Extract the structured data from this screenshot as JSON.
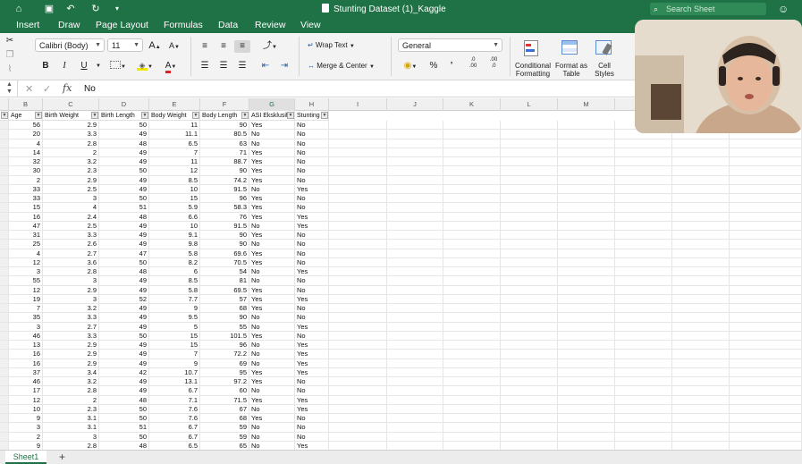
{
  "titlebar": {
    "title": "Stunting Dataset (1)_Kaggle",
    "search_placeholder": "Search Sheet",
    "quick_icons": [
      "home-icon",
      "save-icon",
      "undo-icon",
      "redo-icon",
      "more-icon"
    ]
  },
  "tabs": [
    "Insert",
    "Draw",
    "Page Layout",
    "Formulas",
    "Data",
    "Review",
    "View"
  ],
  "ribbon": {
    "font_name": "Calibri (Body)",
    "font_size": "11",
    "grow_font": "A",
    "shrink_font": "A",
    "bold": "B",
    "italic": "I",
    "underline": "U",
    "font_color_letter": "A",
    "wrap_text": "Wrap Text",
    "merge_center": "Merge & Center",
    "number_format": "General",
    "percent": "%",
    "comma": "’",
    "increase_decimal": ".0\n.00",
    "decrease_decimal": ".00\n.0",
    "conditional_formatting": "Conditional Formatting",
    "format_as_table": "Format as Table",
    "cell_styles": "Cell Styles",
    "accent": "#1e7245"
  },
  "formula_bar": {
    "fx": "fx",
    "value": "No"
  },
  "columns": [
    "B",
    "C",
    "D",
    "E",
    "F",
    "G",
    "H",
    "I",
    "J",
    "K",
    "L",
    "M"
  ],
  "headers": [
    "Age",
    "Birth Weight",
    "Birth Length",
    "Body Weight",
    "Body Length",
    "ASI Eksklusif",
    "Stunting"
  ],
  "rows": [
    [
      "56",
      "2.9",
      "50",
      "11",
      "90",
      "Yes",
      "No"
    ],
    [
      "20",
      "3.3",
      "49",
      "11.1",
      "80.5",
      "No",
      "No"
    ],
    [
      "4",
      "2.8",
      "48",
      "6.5",
      "63",
      "No",
      "No"
    ],
    [
      "14",
      "2",
      "49",
      "7",
      "71",
      "Yes",
      "No"
    ],
    [
      "32",
      "3.2",
      "49",
      "11",
      "88.7",
      "Yes",
      "No"
    ],
    [
      "30",
      "2.3",
      "50",
      "12",
      "90",
      "Yes",
      "No"
    ],
    [
      "2",
      "2.9",
      "49",
      "8.5",
      "74.2",
      "Yes",
      "No"
    ],
    [
      "33",
      "2.5",
      "49",
      "10",
      "91.5",
      "No",
      "Yes"
    ],
    [
      "33",
      "3",
      "50",
      "15",
      "96",
      "Yes",
      "No"
    ],
    [
      "15",
      "4",
      "51",
      "5.9",
      "58.3",
      "Yes",
      "No"
    ],
    [
      "16",
      "2.4",
      "48",
      "6.6",
      "76",
      "Yes",
      "Yes"
    ],
    [
      "47",
      "2.5",
      "49",
      "10",
      "91.5",
      "No",
      "Yes"
    ],
    [
      "31",
      "3.3",
      "49",
      "9.1",
      "90",
      "Yes",
      "No"
    ],
    [
      "25",
      "2.6",
      "49",
      "9.8",
      "90",
      "No",
      "No"
    ],
    [
      "4",
      "2.7",
      "47",
      "5.8",
      "69.6",
      "Yes",
      "No"
    ],
    [
      "12",
      "3.6",
      "50",
      "8.2",
      "70.5",
      "Yes",
      "No"
    ],
    [
      "3",
      "2.8",
      "48",
      "6",
      "54",
      "No",
      "Yes"
    ],
    [
      "55",
      "3",
      "49",
      "8.5",
      "81",
      "No",
      "No"
    ],
    [
      "12",
      "2.9",
      "49",
      "5.8",
      "69.5",
      "Yes",
      "No"
    ],
    [
      "19",
      "3",
      "52",
      "7.7",
      "57",
      "Yes",
      "Yes"
    ],
    [
      "7",
      "3.2",
      "49",
      "9",
      "68",
      "Yes",
      "No"
    ],
    [
      "35",
      "3.3",
      "49",
      "9.5",
      "90",
      "No",
      "No"
    ],
    [
      "3",
      "2.7",
      "49",
      "5",
      "55",
      "No",
      "Yes"
    ],
    [
      "46",
      "3.3",
      "50",
      "15",
      "101.5",
      "Yes",
      "No"
    ],
    [
      "13",
      "2.9",
      "49",
      "15",
      "96",
      "No",
      "Yes"
    ],
    [
      "16",
      "2.9",
      "49",
      "7",
      "72.2",
      "No",
      "Yes"
    ],
    [
      "16",
      "2.9",
      "49",
      "9",
      "69",
      "No",
      "Yes"
    ],
    [
      "37",
      "3.4",
      "42",
      "10.7",
      "95",
      "Yes",
      "Yes"
    ],
    [
      "46",
      "3.2",
      "49",
      "13.1",
      "97.2",
      "Yes",
      "No"
    ],
    [
      "17",
      "2.8",
      "49",
      "6.7",
      "60",
      "No",
      "No"
    ],
    [
      "12",
      "2",
      "48",
      "7.1",
      "71.5",
      "Yes",
      "Yes"
    ],
    [
      "10",
      "2.3",
      "50",
      "7.6",
      "67",
      "No",
      "Yes"
    ],
    [
      "9",
      "3.1",
      "50",
      "7.6",
      "68",
      "Yes",
      "No"
    ],
    [
      "3",
      "3.1",
      "51",
      "6.7",
      "59",
      "No",
      "No"
    ],
    [
      "2",
      "3",
      "50",
      "6.7",
      "59",
      "No",
      "No"
    ],
    [
      "9",
      "2.8",
      "48",
      "6.5",
      "65",
      "No",
      "Yes"
    ]
  ],
  "sheets": [
    "Sheet1"
  ],
  "add_sheet": "+"
}
